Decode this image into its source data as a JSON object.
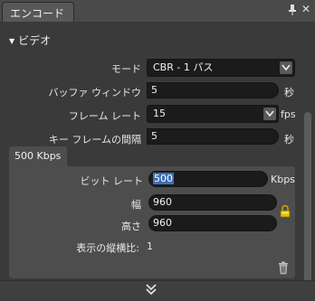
{
  "panel": {
    "tab_title": "エンコード",
    "section_title": "ビデオ"
  },
  "video": {
    "mode": {
      "label": "モード",
      "value": "CBR - 1 パス"
    },
    "buffer": {
      "label": "バッファ ウィンドウ",
      "value": "5",
      "unit": "秒"
    },
    "framerate": {
      "label": "フレーム レート",
      "value": "15",
      "unit": "fps"
    },
    "keyframe": {
      "label": "キー フレームの間隔",
      "value": "5",
      "unit": "秒"
    }
  },
  "bitrate_tab": {
    "label": "500 Kbps"
  },
  "bitrate": {
    "label": "ビット レート",
    "value": "500",
    "unit": "Kbps"
  },
  "width": {
    "label": "幅",
    "value": "960"
  },
  "height": {
    "label": "高さ",
    "value": "960"
  },
  "aspect": {
    "label": "表示の縦横比:",
    "value": "1"
  },
  "icons": {
    "pin": "pin-icon",
    "close": "close-icon",
    "collapse": "triangle-down-icon",
    "lock": "lock-icon",
    "trash": "trash-icon",
    "expand": "double-chevron-down-icon"
  }
}
